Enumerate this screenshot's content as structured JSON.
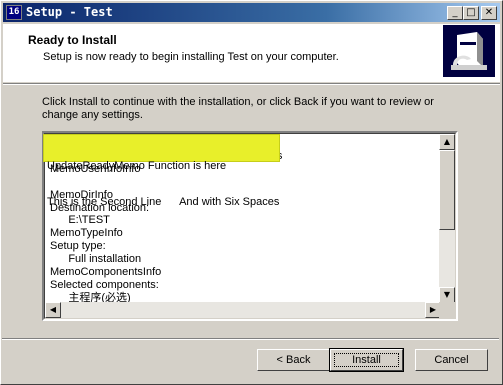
{
  "window": {
    "title": "Setup - Test",
    "app_icon": "16",
    "controls": {
      "minimize": "_",
      "maximize": "□",
      "close": "✕"
    }
  },
  "header": {
    "title": "Ready to Install",
    "subtitle": "Setup is now ready to begin installing Test on your computer."
  },
  "body": {
    "intro": "Click Install to continue with the installation, or click Back if you want to review or change any settings."
  },
  "memo": {
    "lines": [
      "UpdateReadyMemo Function is here",
      "This is the Second Line      And with Six Spaces",
      "MemoUserInfoInfo",
      "",
      "MemoDirInfo",
      "Destination location:",
      "      E:\\TEST",
      "MemoTypeInfo",
      "Setup type:",
      "      Full installation",
      "MemoComponentsInfo",
      "Selected components:",
      "      主程序(必选)"
    ],
    "highlight_color": "#e8ef2a"
  },
  "scroll": {
    "up": "▲",
    "down": "▼",
    "left": "◀",
    "right": "▶"
  },
  "buttons": {
    "back": "< Back",
    "install": "Install",
    "cancel": "Cancel"
  }
}
